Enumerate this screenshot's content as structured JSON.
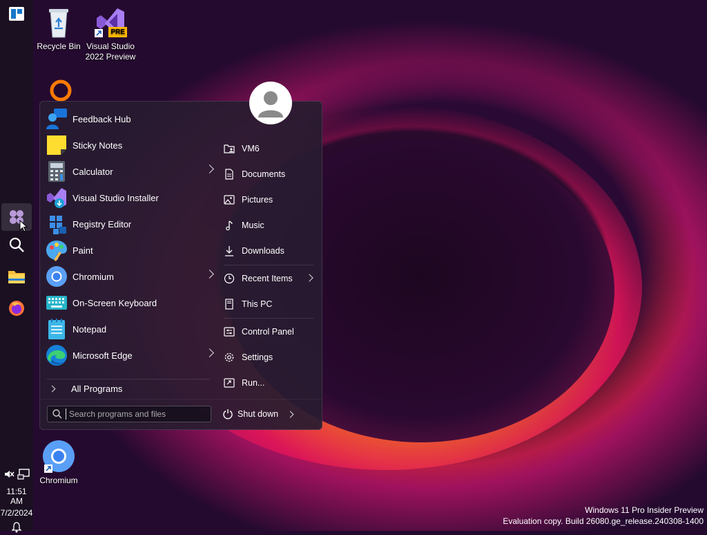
{
  "desktop": {
    "icons": [
      {
        "label_line1": "Recycle Bin",
        "label_line2": ""
      },
      {
        "label_line1": "Visual Studio",
        "label_line2": "2022 Preview",
        "badge": "PRE"
      },
      {
        "label_line1": "Chromium",
        "label_line2": ""
      }
    ]
  },
  "start_menu": {
    "programs": [
      {
        "label": "Feedback Hub",
        "icon": "feedback-hub-icon",
        "has_submenu": false
      },
      {
        "label": "Sticky Notes",
        "icon": "sticky-notes-icon",
        "has_submenu": false
      },
      {
        "label": "Calculator",
        "icon": "calculator-icon",
        "has_submenu": true
      },
      {
        "label": "Visual Studio Installer",
        "icon": "visual-studio-installer-icon",
        "has_submenu": false
      },
      {
        "label": "Registry Editor",
        "icon": "registry-editor-icon",
        "has_submenu": false
      },
      {
        "label": "Paint",
        "icon": "paint-icon",
        "has_submenu": false
      },
      {
        "label": "Chromium",
        "icon": "chromium-icon",
        "has_submenu": true
      },
      {
        "label": "On-Screen Keyboard",
        "icon": "keyboard-icon",
        "has_submenu": false
      },
      {
        "label": "Notepad",
        "icon": "notepad-icon",
        "has_submenu": false
      },
      {
        "label": "Microsoft Edge",
        "icon": "edge-icon",
        "has_submenu": true
      }
    ],
    "all_programs": "All Programs",
    "places": [
      {
        "label": "VM6",
        "icon": "user-folder-icon"
      },
      {
        "label": "Documents",
        "icon": "document-icon"
      },
      {
        "label": "Pictures",
        "icon": "picture-icon"
      },
      {
        "label": "Music",
        "icon": "music-icon"
      },
      {
        "label": "Downloads",
        "icon": "download-icon"
      },
      {
        "label": "Recent Items",
        "icon": "clock-icon"
      },
      {
        "label": "This PC",
        "icon": "computer-icon"
      },
      {
        "label": "Control Panel",
        "icon": "control-panel-icon"
      },
      {
        "label": "Settings",
        "icon": "gear-icon"
      },
      {
        "label": "Run...",
        "icon": "run-icon"
      }
    ],
    "search_placeholder": "Search programs and files",
    "shutdown": "Shut down"
  },
  "taskbar": {
    "time": "11:51 AM",
    "date": "7/2/2024"
  },
  "watermark": {
    "line1": "Windows 11 Pro Insider Preview",
    "line2": "Evaluation copy. Build 26080.ge_release.240308-1400"
  },
  "colors": {
    "accent": "#0078d4",
    "menu_bg": "#281c30"
  }
}
